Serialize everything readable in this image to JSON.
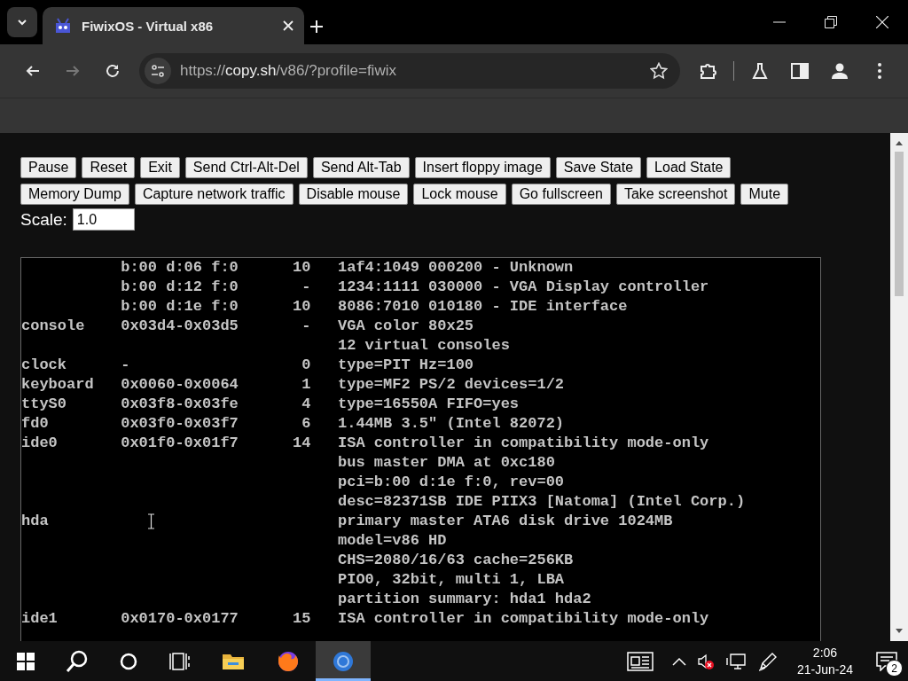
{
  "browser": {
    "tab_title": "FiwixOS - Virtual x86",
    "nav_buttons": [
      {
        "disabled": false
      },
      {
        "disabled": true
      },
      {
        "disabled": false
      }
    ],
    "url": {
      "scheme": "https://",
      "host": "copy.sh",
      "path": "/v86/?profile=fiwix"
    }
  },
  "button_rows": [
    [
      "Pause",
      "Reset",
      "Exit",
      "Send Ctrl-Alt-Del",
      "Send Alt-Tab",
      "Insert floppy image",
      "Save State",
      "Load State"
    ],
    [
      "Memory Dump",
      "Capture network traffic",
      "Disable mouse",
      "Lock mouse",
      "Go fullscreen",
      "Take screenshot",
      "Mute"
    ]
  ],
  "scale": {
    "label": "Scale:",
    "value": "1.0"
  },
  "terminal_rows": [
    {
      "ports": "b:00 d:06 f:0",
      "irq": "10",
      "info": "1af4:1049 000200 - Unknown"
    },
    {
      "ports": "b:00 d:12 f:0",
      "irq": "-",
      "info": "1234:1111 030000 - VGA Display controller"
    },
    {
      "ports": "b:00 d:1e f:0",
      "irq": "10",
      "info": "8086:7010 010180 - IDE interface"
    },
    {
      "device": "console",
      "ports": "0x03d4-0x03d5",
      "irq": "-",
      "info": "VGA color 80x25"
    },
    {
      "info": "12 virtual consoles"
    },
    {
      "device": "clock",
      "ports": "-",
      "irq": "0",
      "info": "type=PIT Hz=100"
    },
    {
      "device": "keyboard",
      "ports": "0x0060-0x0064",
      "irq": "1",
      "info": "type=MF2 PS/2 devices=1/2"
    },
    {
      "device": "ttyS0",
      "ports": "0x03f8-0x03fe",
      "irq": "4",
      "info": "type=16550A FIFO=yes"
    },
    {
      "device": "fd0",
      "ports": "0x03f0-0x03f7",
      "irq": "6",
      "info": "1.44MB 3.5\" (Intel 82072)"
    },
    {
      "device": "ide0",
      "ports": "0x01f0-0x01f7",
      "irq": "14",
      "info": "ISA controller in compatibility mode-only"
    },
    {
      "info": "bus master DMA at 0xc180"
    },
    {
      "info": "pci=b:00 d:1e f:0, rev=00"
    },
    {
      "info": "desc=82371SB IDE PIIX3 [Natoma] (Intel Corp.)"
    },
    {
      "device": "hda",
      "info": "primary master ATA6 disk drive 1024MB"
    },
    {
      "info": "model=v86 HD"
    },
    {
      "info": "CHS=2080/16/63 cache=256KB"
    },
    {
      "info": "PIO0, 32bit, multi 1, LBA"
    },
    {
      "info": "partition summary: hda1 hda2"
    },
    {
      "device": "ide1",
      "ports": "0x0170-0x0177",
      "irq": "15",
      "info": "ISA controller in compatibility mode-only"
    }
  ],
  "taskbar": {
    "apps": [
      {
        "selected": false
      },
      {
        "selected": false
      },
      {
        "selected": true
      }
    ],
    "time": "2:06",
    "date": "21-Jun-24",
    "notification_count": "2"
  }
}
